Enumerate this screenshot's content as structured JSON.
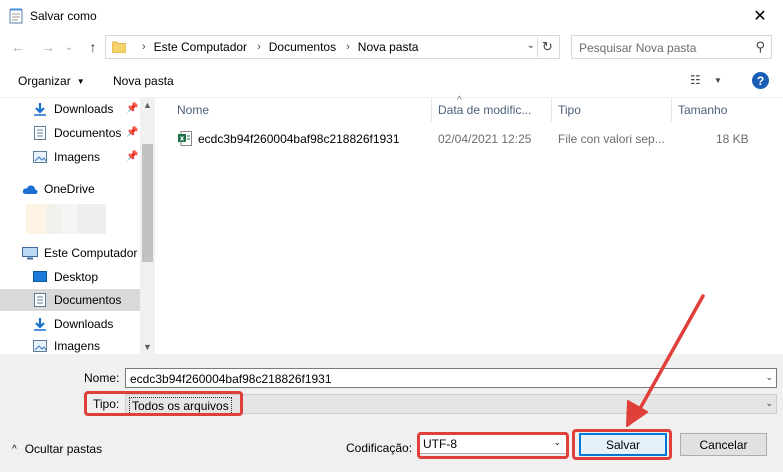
{
  "window": {
    "title": "Salvar como",
    "close_glyph": "✕",
    "accent_color": "#e8663d"
  },
  "navigation": {
    "back_glyph": "←",
    "forward_glyph": "→",
    "recent_glyph": "⌄",
    "up_glyph": "↑",
    "breadcrumb": [
      "Este Computador",
      "Documentos",
      "Nova pasta"
    ],
    "separator": "›",
    "refresh_glyph": "↻",
    "search_placeholder": "Pesquisar Nova pasta"
  },
  "toolbar": {
    "organize_label": "Organizar",
    "new_folder_label": "Nova pasta",
    "help_glyph": "?"
  },
  "sidebar": {
    "items": [
      {
        "label": "Downloads",
        "icon": "download-icon",
        "pinned": true
      },
      {
        "label": "Documentos",
        "icon": "document-icon",
        "pinned": true
      },
      {
        "label": "Imagens",
        "icon": "pictures-icon",
        "pinned": true
      },
      {
        "label": "OneDrive",
        "icon": "cloud-icon",
        "pinned": false
      },
      {
        "label": "Este Computador",
        "icon": "computer-icon",
        "pinned": false
      },
      {
        "label": "Desktop",
        "icon": "desktop-icon",
        "pinned": false
      },
      {
        "label": "Documentos",
        "icon": "document-icon",
        "pinned": false,
        "selected": true
      },
      {
        "label": "Downloads",
        "icon": "download-icon",
        "pinned": false
      },
      {
        "label": "Imagens",
        "icon": "pictures-icon",
        "pinned": false
      }
    ]
  },
  "file_list": {
    "columns": [
      "Nome",
      "Data de modific...",
      "Tipo",
      "Tamanho"
    ],
    "rows": [
      {
        "name": "ecdc3b94f260004baf98c218826f1931",
        "date": "02/04/2021 12:25",
        "type": "File con valori sep...",
        "size": "18 KB",
        "icon": "excel-csv-icon"
      }
    ]
  },
  "save_form": {
    "name_label": "Nome:",
    "name_value": "ecdc3b94f260004baf98c218826f1931",
    "type_label": "Tipo:",
    "type_value": "Todos os arquivos",
    "encoding_label": "Codificação:",
    "encoding_value": "UTF-8",
    "save_label": "Salvar",
    "cancel_label": "Cancelar",
    "hide_folders_label": "Ocultar pastas"
  },
  "annotation_color": "#e0403a"
}
